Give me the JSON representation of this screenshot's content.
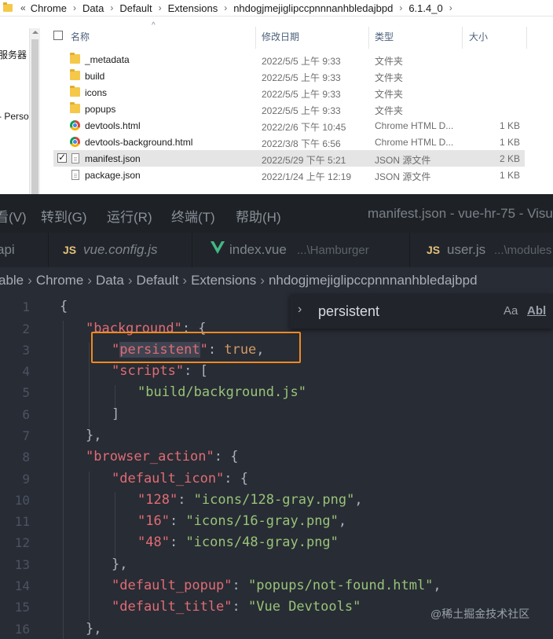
{
  "explorer": {
    "breadcrumb": [
      "«",
      "Chrome",
      "Data",
      "Default",
      "Extensions",
      "nhdogjmejiglipccpnnnanhbledajbpd",
      "6.1.4_0"
    ],
    "nav_items": [
      "服务器",
      "- Perso"
    ],
    "columns": {
      "name": "名称",
      "date": "修改日期",
      "type": "类型",
      "size": "大小"
    },
    "files": [
      {
        "icon": "folder-icon",
        "name": "_metadata",
        "date": "2022/5/5 上午 9:33",
        "type": "文件夹",
        "size": ""
      },
      {
        "icon": "folder-icon",
        "name": "build",
        "date": "2022/5/5 上午 9:33",
        "type": "文件夹",
        "size": ""
      },
      {
        "icon": "folder-icon",
        "name": "icons",
        "date": "2022/5/5 上午 9:33",
        "type": "文件夹",
        "size": ""
      },
      {
        "icon": "folder-icon",
        "name": "popups",
        "date": "2022/5/5 上午 9:33",
        "type": "文件夹",
        "size": ""
      },
      {
        "icon": "chrome-icon",
        "name": "devtools.html",
        "date": "2022/2/6 下午 10:45",
        "type": "Chrome HTML D...",
        "size": "1 KB"
      },
      {
        "icon": "chrome-icon",
        "name": "devtools-background.html",
        "date": "2022/3/8 下午 6:56",
        "type": "Chrome HTML D...",
        "size": "1 KB"
      },
      {
        "icon": "json-file-icon",
        "name": "manifest.json",
        "date": "2022/5/29 下午 5:21",
        "type": "JSON 源文件",
        "size": "2 KB",
        "selected": true,
        "checked": true
      },
      {
        "icon": "json-file-icon",
        "name": "package.json",
        "date": "2022/1/24 上午 12:19",
        "type": "JSON 源文件",
        "size": "1 KB"
      }
    ]
  },
  "vscode": {
    "menu": [
      "看(V)",
      "转到(G)",
      "运行(R)",
      "终端(T)",
      "帮助(H)"
    ],
    "window_title": "manifest.json - vue-hr-75 - Visu",
    "tabs": [
      {
        "icon": "",
        "label": "api",
        "dir": ""
      },
      {
        "icon": "JS",
        "label": "vue.config.js",
        "dir": ""
      },
      {
        "icon": "vue-icon",
        "label": "index.vue",
        "dir": "...\\Hamburger"
      },
      {
        "icon": "JS",
        "label": "user.js",
        "dir": "...\\modules"
      }
    ],
    "breadcrumbs": [
      "able",
      "Chrome",
      "Data",
      "Default",
      "Extensions",
      "nhdogjmejiglipccpnnnanhbledajbpd"
    ],
    "find": {
      "value": "persistent",
      "match_case": "Aa",
      "whole_word": "Abl"
    },
    "code_lines": [
      {
        "n": "1"
      },
      {
        "n": "2"
      },
      {
        "n": "3"
      },
      {
        "n": "4"
      },
      {
        "n": "5"
      },
      {
        "n": "6"
      },
      {
        "n": "7"
      },
      {
        "n": "8"
      },
      {
        "n": "9"
      },
      {
        "n": "10"
      },
      {
        "n": "11"
      },
      {
        "n": "12"
      },
      {
        "n": "13"
      },
      {
        "n": "14"
      },
      {
        "n": "15"
      },
      {
        "n": "16"
      }
    ],
    "tokens": {
      "l1": "{",
      "l2_key": "\"background\"",
      "l2_rest": ": {",
      "l3_q1": "\"",
      "l3_word": "persistent",
      "l3_q2": "\"",
      "l3_colon": ": ",
      "l3_val": "true",
      "l3_end": ",",
      "l4_key": "\"scripts\"",
      "l4_rest": ": [",
      "l5_val": "\"build/background.js\"",
      "l6": "]",
      "l7": "},",
      "l8_key": "\"browser_action\"",
      "l8_rest": ": {",
      "l9_key": "\"default_icon\"",
      "l9_rest": ": {",
      "l10_key": "\"128\"",
      "l10_colon": ": ",
      "l10_val": "\"icons/128-gray.png\"",
      "l10_end": ",",
      "l11_key": "\"16\"",
      "l11_colon": ": ",
      "l11_val": "\"icons/16-gray.png\"",
      "l11_end": ",",
      "l12_key": "\"48\"",
      "l12_colon": ": ",
      "l12_val": "\"icons/48-gray.png\"",
      "l13": "},",
      "l14_key": "\"default_popup\"",
      "l14_colon": ": ",
      "l14_val": "\"popups/not-found.html\"",
      "l14_end": ",",
      "l15_key": "\"default_title\"",
      "l15_colon": ": ",
      "l15_val": "\"Vue Devtools\"",
      "l16": "},"
    }
  },
  "watermark": "@稀土掘金技术社区",
  "colors": {
    "annotation": "#f08a24",
    "editor_bg": "#282c34",
    "json_key": "#e06c75",
    "json_string": "#98c379",
    "json_bool": "#d19a66"
  }
}
